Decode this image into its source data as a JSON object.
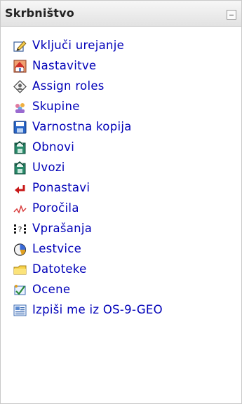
{
  "block": {
    "title": "Skrbništvo",
    "collapse_icon": "minus-box-icon"
  },
  "colors": {
    "link": "#0000b8",
    "header_bg": "#e9e9e9",
    "border": "#c9c9c9"
  },
  "items": [
    {
      "label": "Vključi urejanje",
      "icon": "edit-pencil-icon"
    },
    {
      "label": "Nastavitve",
      "icon": "settings-icon"
    },
    {
      "label": "Assign roles",
      "icon": "assign-roles-icon"
    },
    {
      "label": "Skupine",
      "icon": "groups-icon"
    },
    {
      "label": "Varnostna kopija",
      "icon": "backup-icon"
    },
    {
      "label": "Obnovi",
      "icon": "restore-icon"
    },
    {
      "label": "Uvozi",
      "icon": "import-icon"
    },
    {
      "label": "Ponastavi",
      "icon": "reset-arrow-icon"
    },
    {
      "label": "Poročila",
      "icon": "reports-icon"
    },
    {
      "label": "Vprašanja",
      "icon": "questions-icon"
    },
    {
      "label": "Lestvice",
      "icon": "scales-icon"
    },
    {
      "label": "Datoteke",
      "icon": "folder-icon"
    },
    {
      "label": "Ocene",
      "icon": "grades-icon"
    },
    {
      "label": "Izpiši me iz OS-9-GEO",
      "icon": "unenrol-icon"
    }
  ]
}
